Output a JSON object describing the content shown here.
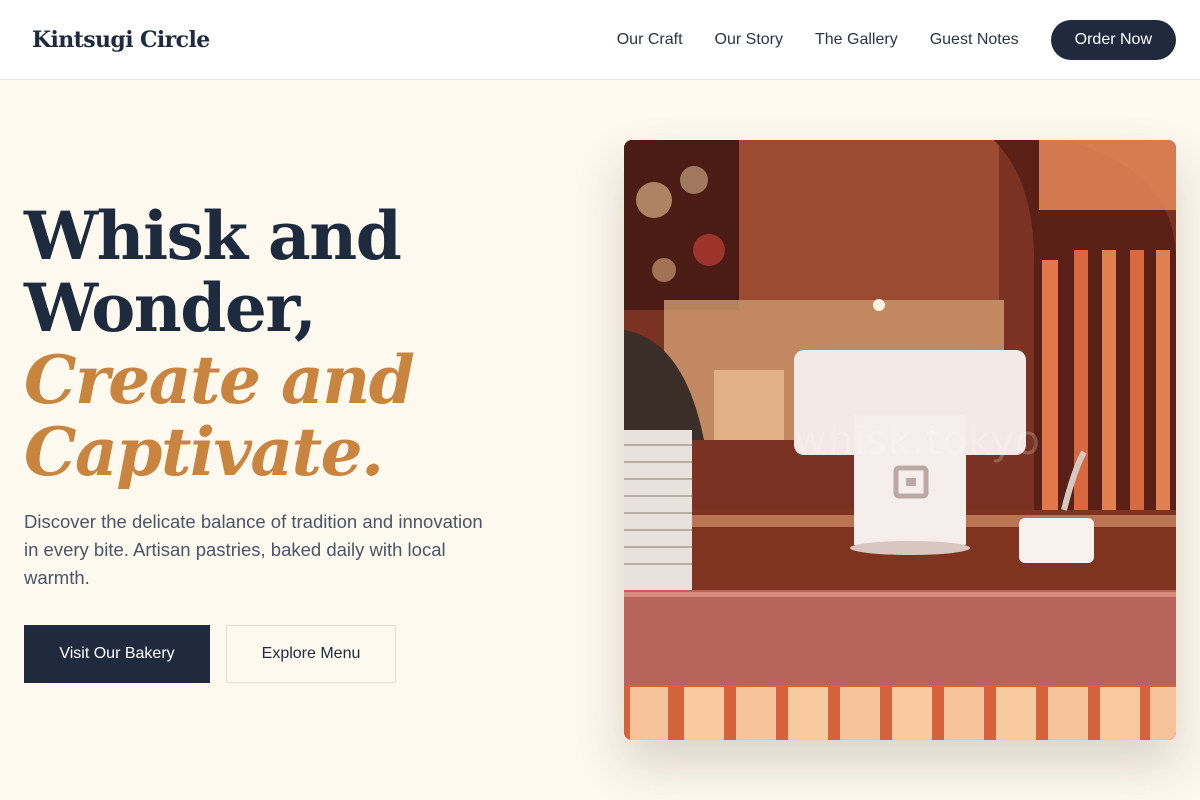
{
  "nav": {
    "brand": "Kintsugi Circle",
    "links": [
      "Our Craft",
      "Our Story",
      "The Gallery",
      "Guest Notes"
    ],
    "cta": "Order Now"
  },
  "hero": {
    "line1": "Whisk and",
    "line2": "Wonder,",
    "line3": "Create and",
    "line4": "Captivate.",
    "description": "Discover the delicate balance of tradition and innovation in every bite. Artisan pastries, baked daily with local warmth.",
    "primary_cta": "Visit Our Bakery",
    "secondary_cta": "Explore Menu"
  },
  "image": {
    "watermark": "whisk.tokyo"
  },
  "colors": {
    "navy": "#1f2a3e",
    "accent": "#c9843f",
    "cream": "#fdf9ef"
  }
}
